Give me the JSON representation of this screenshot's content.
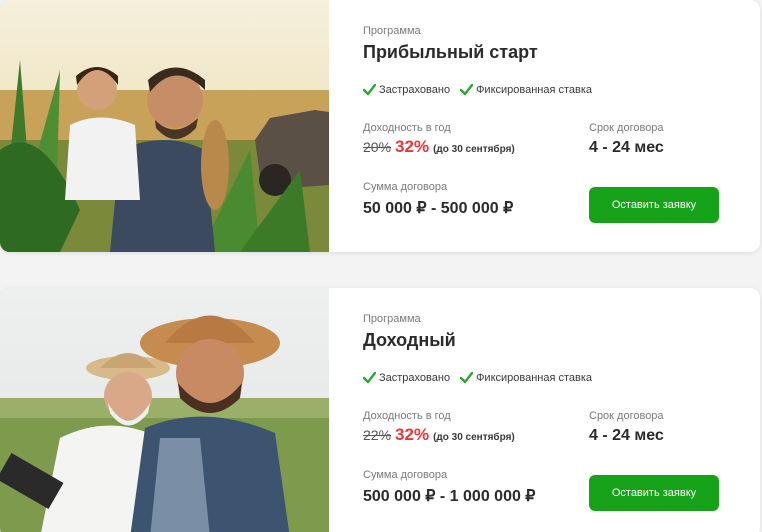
{
  "programs": [
    {
      "program_label": "Программа",
      "title": "Прибыльный старт",
      "features": [
        "Застраховано",
        "Фиксированная ставка"
      ],
      "yield_label": "Доходность в год",
      "old_rate": "20%",
      "new_rate": "32%",
      "rate_note": "(до 30 сентября)",
      "term_label": "Срок договора",
      "term_value": "4 - 24 мес",
      "sum_label": "Сумма договора",
      "sum_value": "50 000 ₽  - 500 000 ₽",
      "button_label": "Оставить заявку"
    },
    {
      "program_label": "Программа",
      "title": "Доходный",
      "features": [
        "Застраховано",
        "Фиксированная ставка"
      ],
      "yield_label": "Доходность в год",
      "old_rate": "22%",
      "new_rate": "32%",
      "rate_note": "(до 30 сентября)",
      "term_label": "Срок договора",
      "term_value": "4 - 24 мес",
      "sum_label": "Сумма договора",
      "sum_value": "500 000 ₽  - 1 000 000 ₽",
      "button_label": "Оставить заявку"
    }
  ],
  "colors": {
    "accent_green": "#16a31a",
    "rate_red": "#e53935",
    "check_green": "#2fa52f"
  },
  "icons": {
    "check": "check-icon"
  }
}
